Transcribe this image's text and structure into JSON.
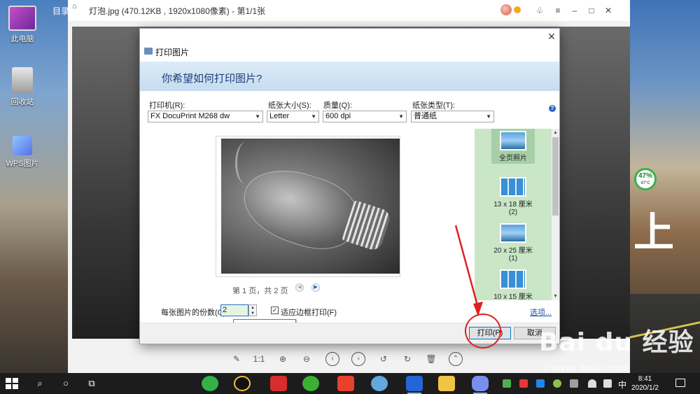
{
  "desktop": {
    "icons": [
      {
        "label": "此电脑"
      },
      {
        "label": "回收站"
      },
      {
        "label": "WPS图片"
      }
    ],
    "wallpaper_char": "上",
    "gauge": {
      "percent": "47%",
      "temp": "47°C"
    }
  },
  "viewer": {
    "tab_label": "目录",
    "title": "灯泡.jpg (470.12KB , 1920x1080像素) - 第1/1张",
    "toolbar": {
      "zoom_1to1": "1:1"
    }
  },
  "dialog": {
    "app_title": "打印图片",
    "heading": "你希望如何打印图片?",
    "close_glyph": "✕",
    "printer": {
      "label": "打印机(R):",
      "value": "FX DocuPrint M268 dw"
    },
    "paper_size": {
      "label": "纸张大小(S):",
      "value": "Letter"
    },
    "quality": {
      "label": "质量(Q):",
      "value": "600 dpi"
    },
    "paper_type": {
      "label": "纸张类型(T):",
      "value": "普通纸"
    },
    "help_glyph": "?",
    "page_indicator": "第 1 页，共 2 页",
    "layouts": [
      {
        "label": "全页照片",
        "selected": true
      },
      {
        "label": "13 x 18 厘米 (2)"
      },
      {
        "label": "20 x 25 厘米 (1)"
      },
      {
        "label": "10 x 15 厘米 (2)"
      }
    ],
    "copies": {
      "label": "每张图片的份数(C):",
      "value": "2"
    },
    "fit_frame": {
      "label": "适应边框打印(F)",
      "checked": true
    },
    "options_link": "选项...",
    "tooltip": "选择要打印的份数",
    "buttons": {
      "print": "打印(P)",
      "cancel": "取消"
    }
  },
  "taskbar": {
    "ime": "中",
    "time": "8:41",
    "date": "2020/1/2"
  },
  "watermark": {
    "brand": "Bai du 经验",
    "url": "jingyan.baidu.com"
  },
  "colors": {
    "accent": "#0078d7",
    "annotation": "#e02020",
    "layout_panel": "#c9e6c6",
    "header_band": "#dcebf7"
  }
}
